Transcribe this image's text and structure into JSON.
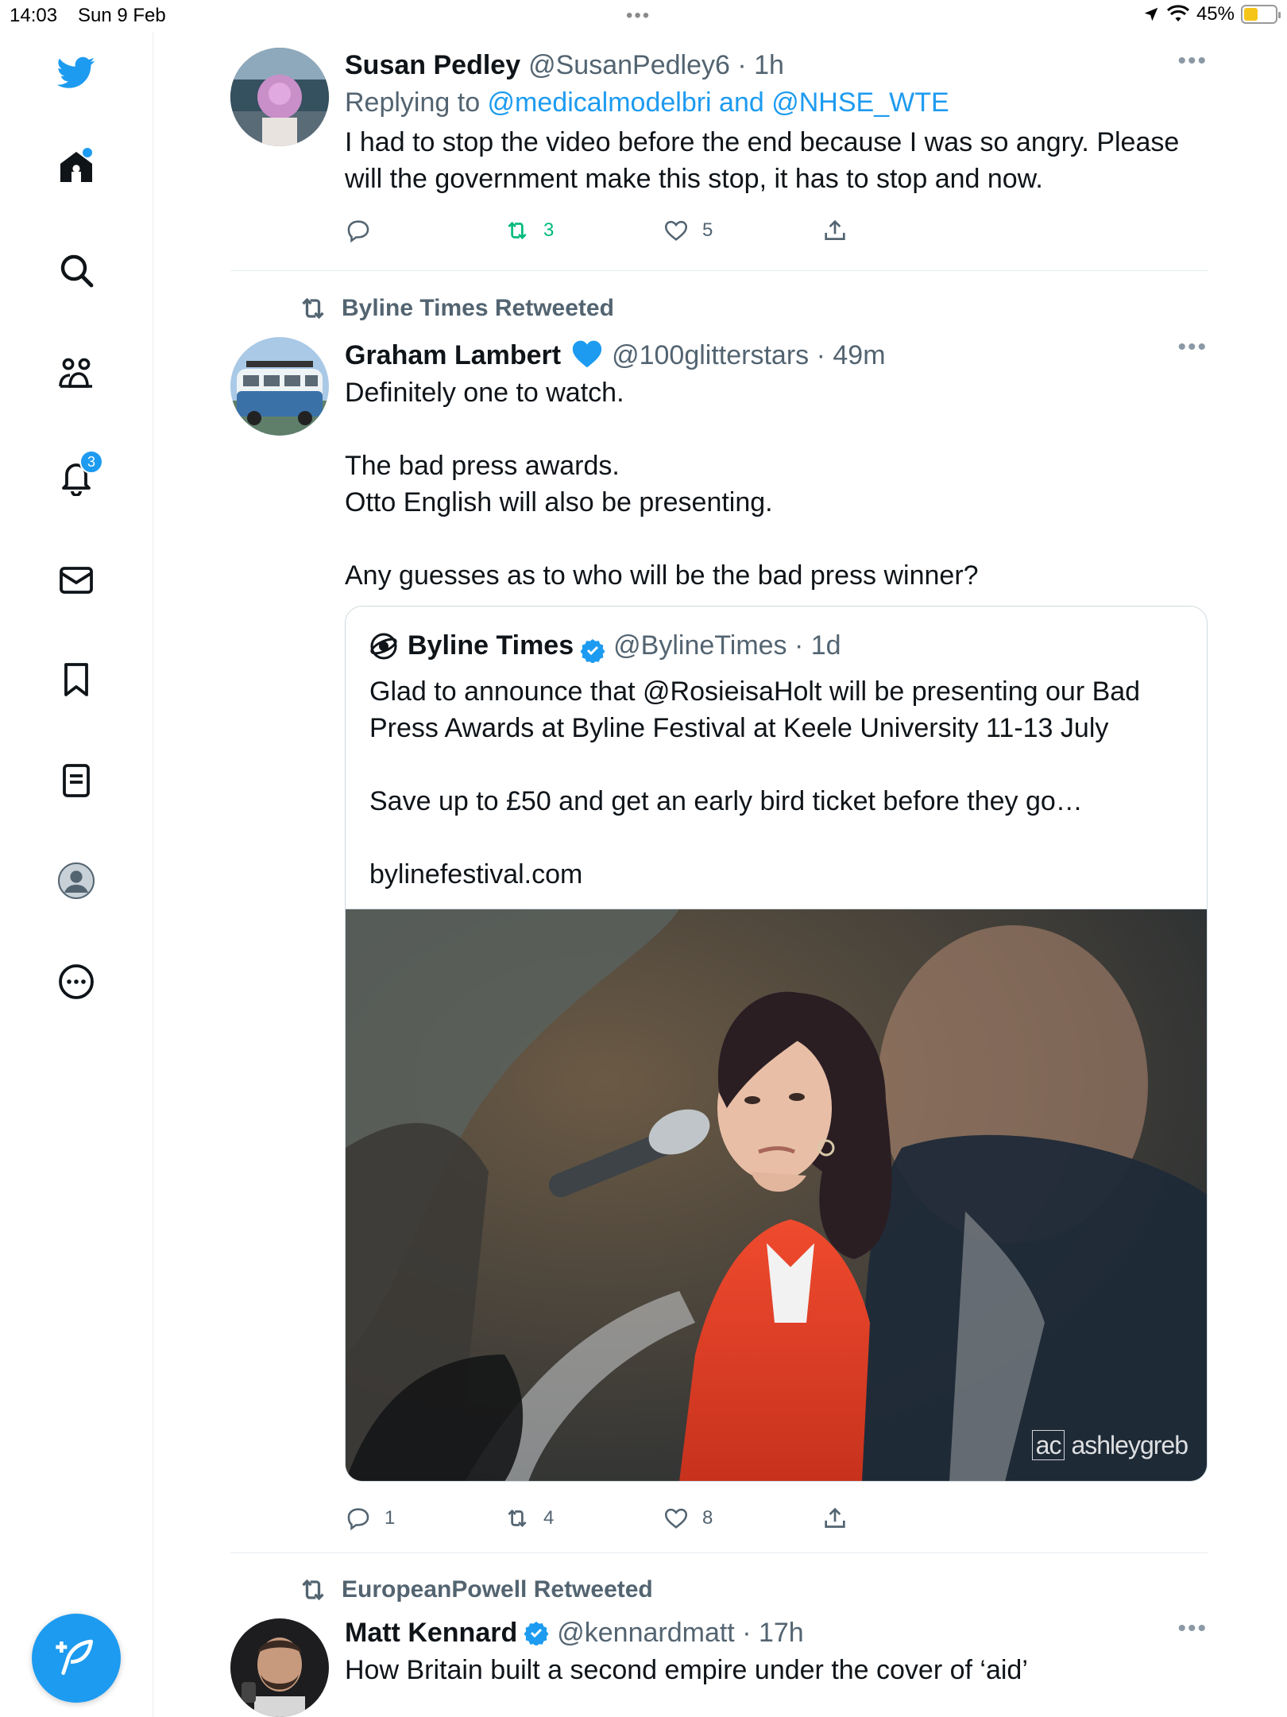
{
  "status_bar": {
    "time": "14:03",
    "date": "Sun 9 Feb",
    "battery": "45%",
    "dots": "•••"
  },
  "sidebar": {
    "icons": [
      "twitter-bird-icon",
      "home-icon",
      "search-icon",
      "communities-icon",
      "notifications-icon",
      "messages-icon",
      "bookmarks-icon",
      "lists-icon",
      "profile-icon",
      "more-icon"
    ],
    "notifications_count": "3"
  },
  "tweets": [
    {
      "name": "Susan Pedley",
      "handle": "@SusanPedley6 · 1h",
      "replying_prefix": "Replying to ",
      "replying_to": "@medicalmodelbri and @NHSE_WTE",
      "text": "I had to stop the video before the end because I was so angry. Please will the government make this stop, it has to stop and now.",
      "replies": "",
      "retweets": "3",
      "likes": "5"
    },
    {
      "retweeted_by": "Byline Times Retweeted",
      "name": "Graham Lambert",
      "handle": "@100glitterstars · 49m",
      "text": "Definitely one to watch.\n\nThe bad press awards.\nOtto English will also be presenting.\n\nAny guesses as to who will be the bad press winner?",
      "quote": {
        "name": "Byline Times",
        "handle": "@BylineTimes · 1d",
        "text": "Glad to announce that @RosieisaHolt will be presenting our Bad Press Awards at Byline Festival at Keele University 11-13 July\n\nSave up to £50 and get an early bird ticket before they go…\n\nbylinefestival.com",
        "watermark": "ashleygreb",
        "watermark_logo": "ac"
      },
      "replies": "1",
      "retweets": "4",
      "likes": "8"
    },
    {
      "retweeted_by": "EuropeanPowell Retweeted",
      "name": "Matt Kennard",
      "handle": "@kennardmatt · 17h",
      "text": "How Britain built a second empire under the cover of ‘aid’"
    }
  ],
  "more_label": "•••",
  "colors": {
    "accent": "#1d9bf0",
    "retweet_active": "#00ba7c",
    "secondary_text": "#536471",
    "heart_blue": "#1d9bf0"
  }
}
